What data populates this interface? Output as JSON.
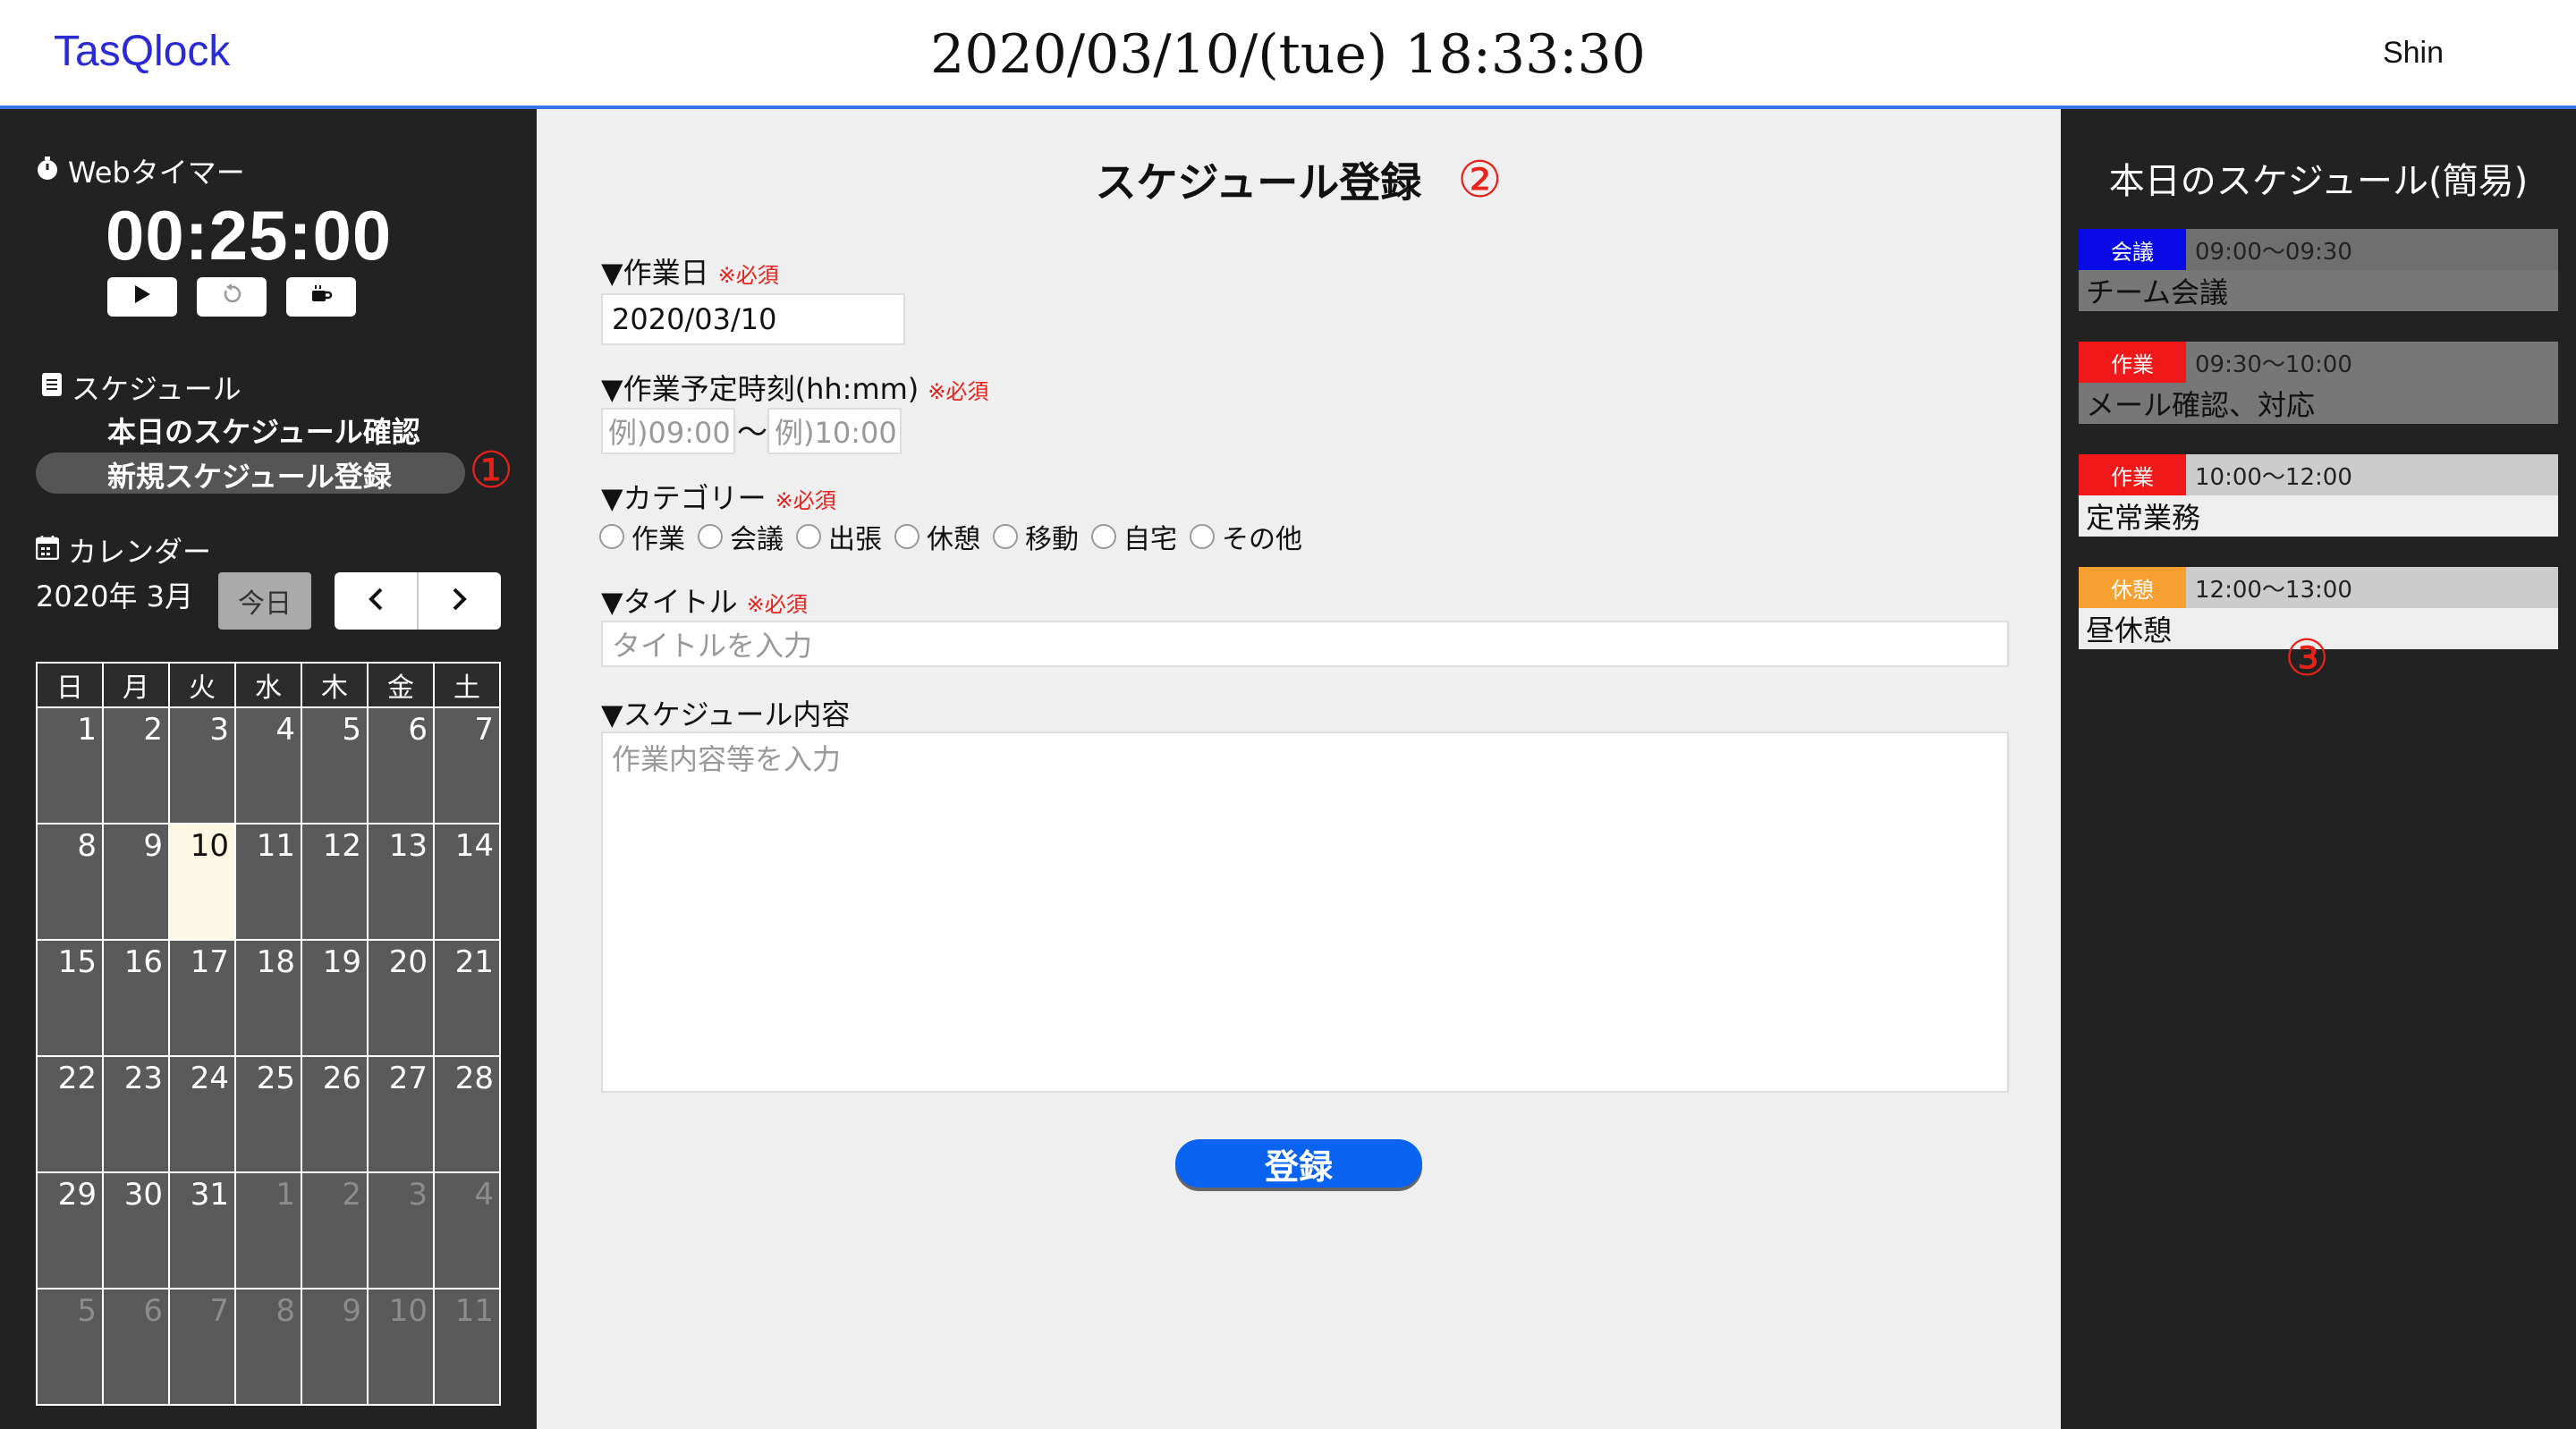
{
  "header": {
    "brand": "TasQlock",
    "datetime": "2020/03/10/(tue) 18:33:30",
    "user": "Shin"
  },
  "sidebar": {
    "timer": {
      "title": "Webタイマー",
      "value": "00:25:00"
    },
    "schedule": {
      "title": "スケジュール",
      "links": [
        "本日のスケジュール確認",
        "新規スケジュール登録"
      ],
      "marker": "①"
    },
    "calendar": {
      "title": "カレンダー",
      "month": "2020年 3月",
      "today_btn": "今日",
      "weekdays": [
        "日",
        "月",
        "火",
        "水",
        "木",
        "金",
        "土"
      ],
      "weeks": [
        [
          {
            "d": "1"
          },
          {
            "d": "2"
          },
          {
            "d": "3"
          },
          {
            "d": "4"
          },
          {
            "d": "5"
          },
          {
            "d": "6"
          },
          {
            "d": "7"
          }
        ],
        [
          {
            "d": "8"
          },
          {
            "d": "9"
          },
          {
            "d": "10",
            "today": true
          },
          {
            "d": "11"
          },
          {
            "d": "12"
          },
          {
            "d": "13"
          },
          {
            "d": "14"
          }
        ],
        [
          {
            "d": "15"
          },
          {
            "d": "16"
          },
          {
            "d": "17"
          },
          {
            "d": "18"
          },
          {
            "d": "19"
          },
          {
            "d": "20"
          },
          {
            "d": "21"
          }
        ],
        [
          {
            "d": "22"
          },
          {
            "d": "23"
          },
          {
            "d": "24"
          },
          {
            "d": "25"
          },
          {
            "d": "26"
          },
          {
            "d": "27"
          },
          {
            "d": "28"
          }
        ],
        [
          {
            "d": "29"
          },
          {
            "d": "30"
          },
          {
            "d": "31"
          },
          {
            "d": "1",
            "other": true
          },
          {
            "d": "2",
            "other": true
          },
          {
            "d": "3",
            "other": true
          },
          {
            "d": "4",
            "other": true
          }
        ],
        [
          {
            "d": "5",
            "other": true
          },
          {
            "d": "6",
            "other": true
          },
          {
            "d": "7",
            "other": true
          },
          {
            "d": "8",
            "other": true
          },
          {
            "d": "9",
            "other": true
          },
          {
            "d": "10",
            "other": true
          },
          {
            "d": "11",
            "other": true
          }
        ]
      ]
    }
  },
  "form": {
    "title": "スケジュール登録",
    "marker": "②",
    "date_label": "▼作業日",
    "required": "※必須",
    "date_value": "2020/03/10",
    "time_label": "▼作業予定時刻(hh:mm)",
    "time_start_ph": "例)09:00",
    "time_sep": "〜",
    "time_end_ph": "例)10:00",
    "category_label": "▼カテゴリー",
    "categories": [
      "作業",
      "会議",
      "出張",
      "休憩",
      "移動",
      "自宅",
      "その他"
    ],
    "title_label": "▼タイトル",
    "title_ph": "タイトルを入力",
    "content_label": "▼スケジュール内容",
    "content_ph": "作業内容等を入力",
    "submit": "登録"
  },
  "today_schedule": {
    "title": "本日のスケジュール(簡易)",
    "marker": "③",
    "items": [
      {
        "category": "会議",
        "color": "#0a0ae6",
        "time": "09:00〜09:30",
        "title": "チーム会議",
        "titleBg": "#777777",
        "timeBg": "#6f6f6f"
      },
      {
        "category": "作業",
        "color": "#f01818",
        "time": "09:30〜10:00",
        "title": "メール確認、対応",
        "titleBg": "#777777",
        "timeBg": "#777777"
      },
      {
        "category": "作業",
        "color": "#f01818",
        "time": "10:00〜12:00",
        "title": "定常業務",
        "titleBg": "#eeeeee",
        "timeBg": "#cccccc"
      },
      {
        "category": "休憩",
        "color": "#f5a031",
        "time": "12:00〜13:00",
        "title": "昼休憩",
        "titleBg": "#eeeeee",
        "timeBg": "#cccccc"
      }
    ]
  }
}
